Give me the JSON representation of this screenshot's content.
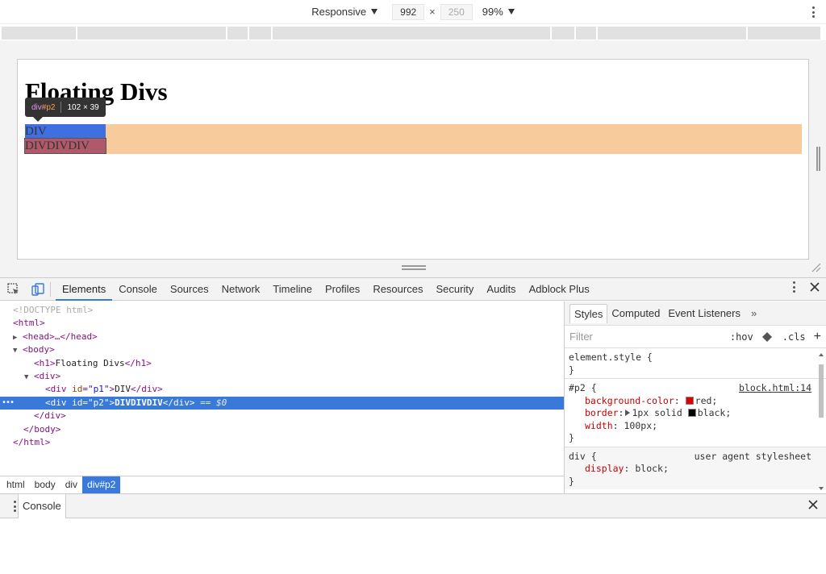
{
  "device_toolbar": {
    "mode": "Responsive",
    "width": "992",
    "times": "×",
    "height": "250",
    "zoom": "99%"
  },
  "page": {
    "heading": "Floating Divs",
    "p1_text": "DIV",
    "p2_text": "DIVDIVDIV"
  },
  "tooltip": {
    "tag": "div",
    "id": "#p2",
    "size": "102 × 39"
  },
  "devtools_tabs": [
    "Elements",
    "Console",
    "Sources",
    "Network",
    "Timeline",
    "Profiles",
    "Resources",
    "Security",
    "Audits",
    "Adblock Plus"
  ],
  "dom": {
    "doctype": "<!DOCTYPE html>",
    "html_open": "<html>",
    "head": "<head>…</head>",
    "body_open": "<body>",
    "h1_open": "<h1>",
    "h1_text": "Floating Divs",
    "h1_close": "</h1>",
    "div_open": "<div>",
    "p1_open": "<div ",
    "id_attr": "id",
    "p1_value": "\"p1\"",
    "p1_text": "DIV",
    "div_close": "</div>",
    "p2_value": "\"p2\"",
    "p2_text": "DIVDIVDIV",
    "eq": "== $0",
    "body_close": "</body>",
    "html_close": "</html>"
  },
  "breadcrumbs": [
    "html",
    "body",
    "div",
    "div#p2"
  ],
  "styles_tabs": [
    "Styles",
    "Computed",
    "Event Listeners"
  ],
  "styles": {
    "filter_placeholder": "Filter",
    "hov": ":hov",
    "cls": ".cls",
    "element_style": "element.style {",
    "p2_selector": "#p2 {",
    "p2_source": "block.html:14",
    "bg_prop": "background-color",
    "bg_value": "red;",
    "border_prop": "border",
    "border_value_a": "1px solid",
    "border_value_b": "black;",
    "width_prop": "width",
    "width_value": "100px;",
    "div_selector": "div {",
    "ua_source": "user agent stylesheet",
    "display_prop": "display",
    "display_value": "block;",
    "close_brace": "}",
    "colon": ":",
    "red_color": "#e00000",
    "black_color": "#000000"
  },
  "drawer": {
    "tab": "Console"
  }
}
